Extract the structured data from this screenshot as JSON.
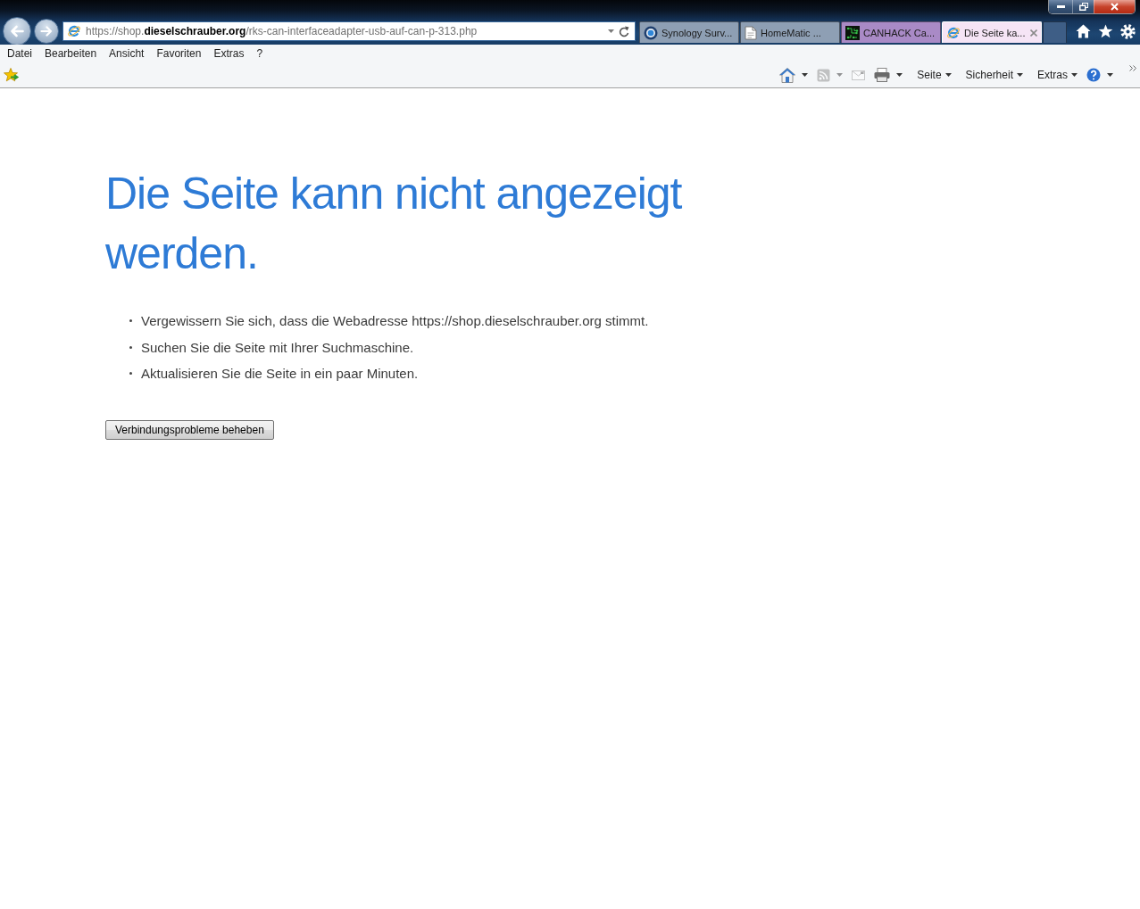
{
  "address_bar": {
    "url": "https://shop.**dieselschrauber.org**/rks-can-interfaceadapter-usb-auf-can-p-313.php"
  },
  "tabs": [
    {
      "kind": "orb",
      "title": "Synology Surv...",
      "selected": false,
      "color": "#8e9fb4"
    },
    {
      "kind": "page",
      "title": "HomeMatic ...",
      "selected": false,
      "color": "#8e9fb4"
    },
    {
      "kind": "circuit",
      "title": "CANHACK Ca...",
      "selected": false,
      "color": "#a98ac6"
    },
    {
      "kind": "browser",
      "title": "Die Seite ka...",
      "selected": true,
      "color": "#f5e4f5"
    }
  ],
  "menu_bar": [
    "Datei",
    "Bearbeiten",
    "Ansicht",
    "Favoriten",
    "Extras",
    "?"
  ],
  "command_bar": [
    {
      "kind": "home",
      "dropdown": true,
      "disabled": false
    },
    {
      "kind": "feed",
      "dropdown": true,
      "disabled": true
    },
    {
      "kind": "mail",
      "dropdown": false,
      "disabled": true
    },
    {
      "kind": "print",
      "dropdown": true,
      "disabled": false
    },
    {
      "kind": "menu",
      "label": "Seite"
    },
    {
      "kind": "menu",
      "label": "Sicherheit"
    },
    {
      "kind": "menu",
      "label": "Extras"
    },
    {
      "kind": "help",
      "dropdown": true,
      "disabled": false
    }
  ],
  "error_page": {
    "heading": "Die Seite kann nicht angezeigt werden.",
    "tips": [
      "Vergewissern Sie sich, dass die Webadresse https://shop.dieselschrauber.org stimmt.",
      "Suchen Sie die Seite mit Ihrer Suchmaschine.",
      "Aktualisieren Sie die Seite in ein paar Minuten."
    ],
    "button": "Verbindungsprobleme beheben"
  }
}
